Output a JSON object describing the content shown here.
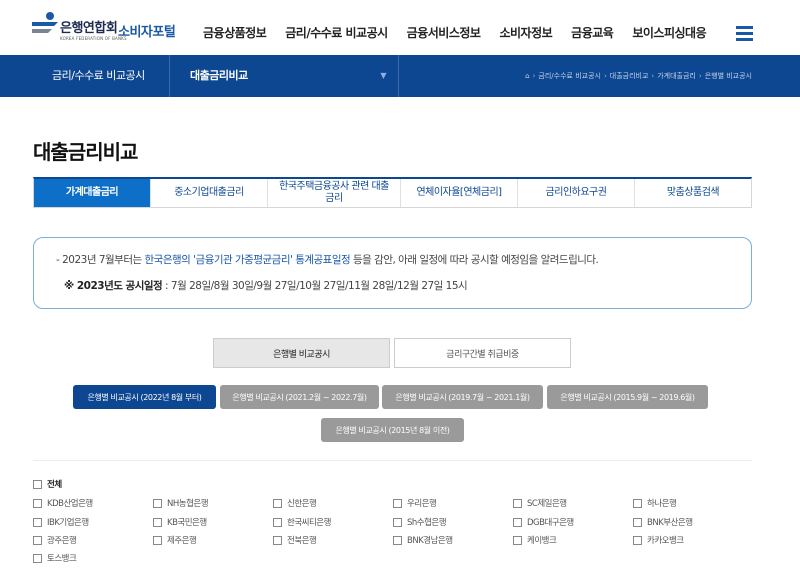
{
  "header": {
    "logo_name": "은행연합회",
    "logo_sub": "KOREA FEDERATION OF BANKS",
    "logo_portal": "소비자포털",
    "nav": [
      "금융상품정보",
      "금리/수수료 비교공시",
      "금융서비스정보",
      "소비자정보",
      "금융교육",
      "보이스피싱대응"
    ]
  },
  "subbar": {
    "section": "금리/수수료 비교공시",
    "current": "대출금리비교",
    "breadcrumb": [
      "금리/수수료 비교공시",
      "대출금리비교",
      "가계대출금리",
      "은행별 비교공시"
    ]
  },
  "page_title": "대출금리비교",
  "tabs": [
    {
      "label": "가계대출금리",
      "active": true
    },
    {
      "label": "중소기업대출금리",
      "active": false
    },
    {
      "label": "한국주택금융공사 관련 대출금리",
      "active": false
    },
    {
      "label": "연체이자율[연체금리]",
      "active": false
    },
    {
      "label": "금리인하요구권",
      "active": false
    },
    {
      "label": "맞춤상품검색",
      "active": false
    }
  ],
  "notice": {
    "line1_a": "- 2023년 7월부터는 ",
    "line1_hl": "한국은행의 '금융기관 가중평균금리' 통계공표일정",
    "line1_b": " 등을 감안, 아래 일정에 따라 공시할 예정임을 알려드립니다.",
    "line2_bold": "※ 2023년도 공시일정",
    "line2_rest": " : 7월 28일/8월 30일/9월 27일/10월 27일/11월 28일/12월 27일 15시"
  },
  "toggle": [
    "은행별 비교공시",
    "금리구간별 취급비중"
  ],
  "periods": [
    "은행별 비교공시 (2022년 8월 부터)",
    "은행별 비교공시 (2021.2월 ~ 2022.7월)",
    "은행별 비교공시 (2019.7월 ~ 2021.1월)",
    "은행별 비교공시 (2015.9월 ~ 2019.6월)",
    "은행별 비교공시 (2015년 8월 이전)"
  ],
  "select_all": "전체",
  "banks": [
    "KDB산업은행",
    "NH농협은행",
    "신한은행",
    "우리은행",
    "SC제일은행",
    "하나은행",
    "IBK기업은행",
    "KB국민은행",
    "한국씨티은행",
    "Sh수협은행",
    "DGB대구은행",
    "BNK부산은행",
    "광주은행",
    "제주은행",
    "전북은행",
    "BNK경남은행",
    "케이뱅크",
    "카카오뱅크",
    "토스뱅크"
  ],
  "colors": {
    "primary": "#0d4691",
    "accent": "#0d6fc7",
    "button_gray": "#9a9a9a"
  }
}
